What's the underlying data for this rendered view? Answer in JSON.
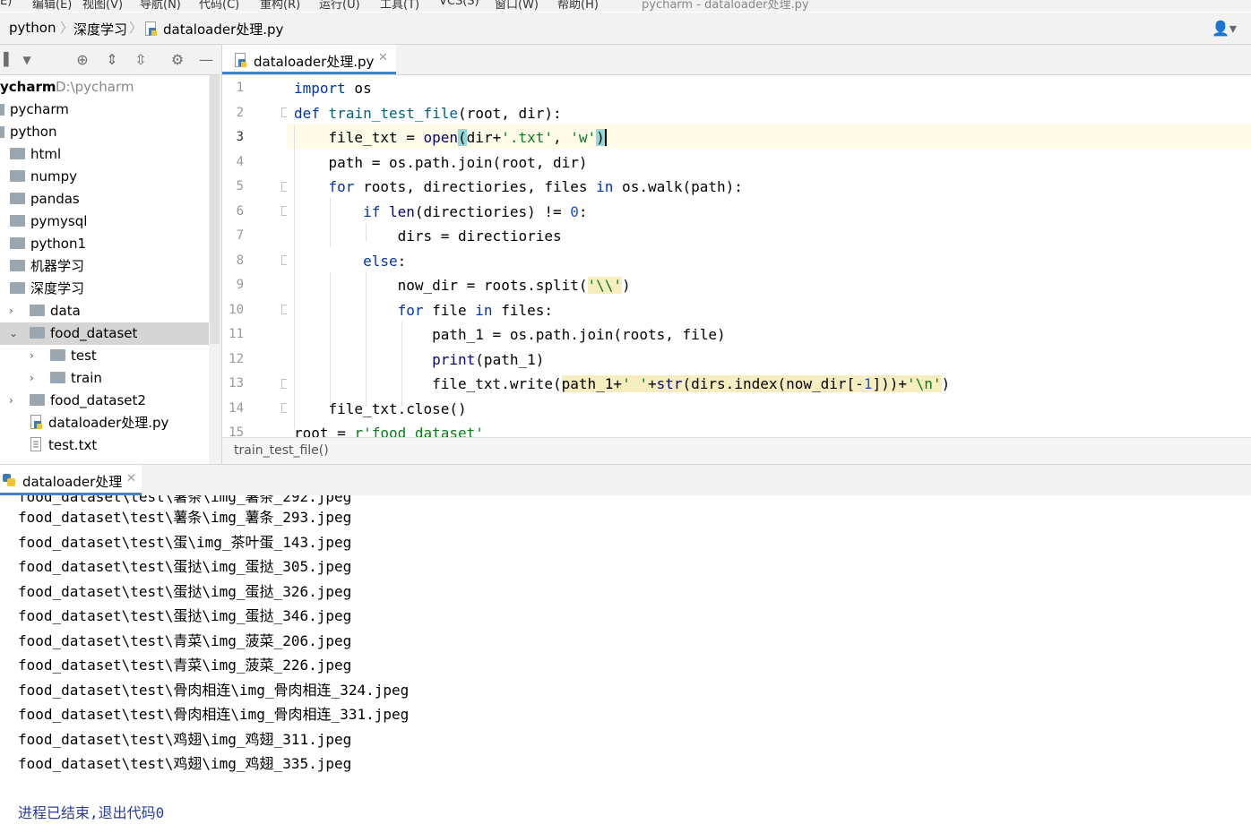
{
  "menu": {
    "items": [
      "E)",
      "编辑(E)",
      "视图(V)",
      "导航(N)",
      "代码(C)",
      "重构(R)",
      "运行(U)",
      "工具(T)",
      "VCS(S)",
      "窗口(W)",
      "帮助(H)"
    ],
    "window_title": "pycharm - dataloader处理.py"
  },
  "breadcrumb": [
    "python",
    "深度学习",
    "dataloader处理.py"
  ],
  "project": {
    "root_label": "ycharm",
    "root_path": "D:\\pycharm",
    "items": [
      {
        "label": "pycharm"
      },
      {
        "label": "python"
      },
      {
        "label": "html"
      },
      {
        "label": "numpy"
      },
      {
        "label": "pandas"
      },
      {
        "label": "pymysql"
      },
      {
        "label": "python1"
      },
      {
        "label": "机器学习"
      },
      {
        "label": "深度学习"
      },
      {
        "label": "data"
      },
      {
        "label": "food_dataset"
      },
      {
        "label": "test"
      },
      {
        "label": "train"
      },
      {
        "label": "food_dataset2"
      },
      {
        "label": "dataloader处理.py"
      },
      {
        "label": "test.txt"
      }
    ]
  },
  "editor": {
    "tab_label": "dataloader处理.py",
    "line_numbers": [
      "1",
      "2",
      "3",
      "4",
      "5",
      "6",
      "7",
      "8",
      "9",
      "10",
      "11",
      "12",
      "13",
      "14",
      "15"
    ],
    "breadcrumb_fn": "train_test_file()"
  },
  "run": {
    "tab_label": "dataloader处理",
    "output_lines": [
      "food_dataset\\test\\薯条\\img_薯条_293.jpeg",
      "food_dataset\\test\\蛋\\img_茶叶蛋_143.jpeg",
      "food_dataset\\test\\蛋挞\\img_蛋挞_305.jpeg",
      "food_dataset\\test\\蛋挞\\img_蛋挞_326.jpeg",
      "food_dataset\\test\\蛋挞\\img_蛋挞_346.jpeg",
      "food_dataset\\test\\青菜\\img_菠菜_206.jpeg",
      "food_dataset\\test\\青菜\\img_菠菜_226.jpeg",
      "food_dataset\\test\\骨肉相连\\img_骨肉相连_324.jpeg",
      "food_dataset\\test\\骨肉相连\\img_骨肉相连_331.jpeg",
      "food_dataset\\test\\鸡翅\\img_鸡翅_311.jpeg",
      "food_dataset\\test\\鸡翅\\img_鸡翅_335.jpeg"
    ],
    "exit_message": "进程已结束,退出代码0"
  }
}
